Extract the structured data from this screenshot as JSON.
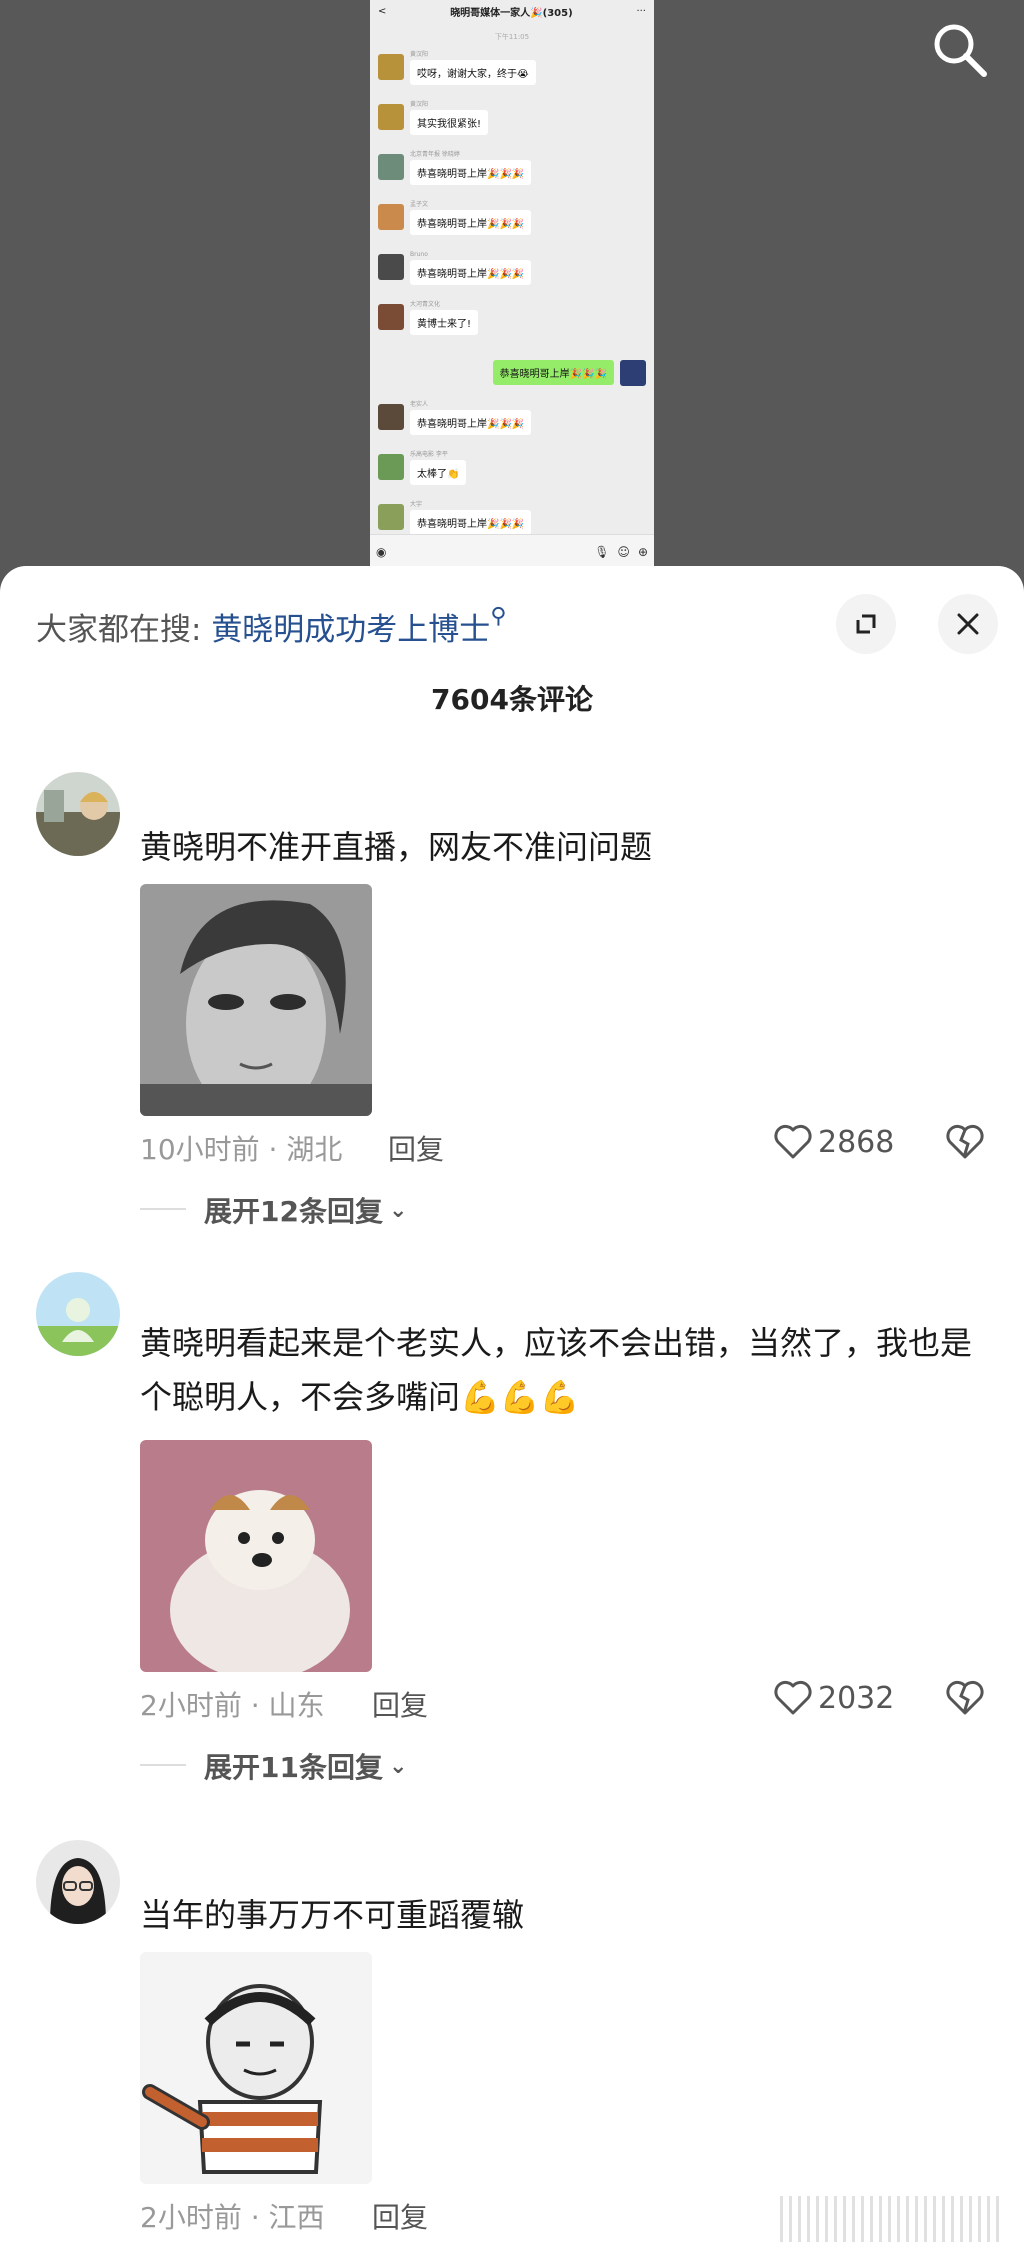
{
  "chat": {
    "title": "晓明哥媒体一家人🎉(305)",
    "back": "<",
    "more": "···",
    "time": "下午11:05",
    "messages": [
      {
        "name": "黄汉阳",
        "text": "哎呀，谢谢大家，终于😭"
      },
      {
        "name": "黄汉阳",
        "text": "其实我很紧张!"
      },
      {
        "name": "北京青年报 徐晓婷",
        "text": "恭喜晓明哥上岸🎉🎉🎉"
      },
      {
        "name": "孟子文",
        "text": "恭喜晓明哥上岸🎉🎉🎉"
      },
      {
        "name": "Bruno",
        "text": "恭喜晓明哥上岸🎉🎉🎉"
      },
      {
        "name": "大河青文化",
        "text": "黄博士来了!"
      },
      {
        "name": "",
        "text": "恭喜晓明哥上岸🎉🎉🎉",
        "self": true
      },
      {
        "name": "老实人",
        "text": "恭喜晓明哥上岸🎉🎉🎉"
      },
      {
        "name": "乐高电影 李平",
        "text": "太棒了👏"
      },
      {
        "name": "大宇",
        "text": "恭喜晓明哥上岸🎉🎉🎉"
      }
    ]
  },
  "sheet": {
    "search_prefix": "大家都在搜:",
    "search_keyword": "黄晓明成功考上博士",
    "comment_count": "7604条评论"
  },
  "comments": [
    {
      "text": "黄晓明不准开直播，网友不准问问题",
      "time_location": "10小时前 · 湖北",
      "reply_label": "回复",
      "likes": "2868",
      "expand_label": "展开12条回复"
    },
    {
      "text": "黄晓明看起来是个老实人，应该不会出错，当然了，我也是个聪明人，不会多嘴问💪💪💪",
      "time_location": "2小时前 · 山东",
      "reply_label": "回复",
      "likes": "2032",
      "expand_label": "展开11条回复"
    },
    {
      "text": "当年的事万万不可重蹈覆辙",
      "time_location": "2小时前 · 江西",
      "reply_label": "回复"
    }
  ],
  "colors": {
    "keyword": "#26508f",
    "top_background": "#585858",
    "chat_self_bubble": "#95ec69"
  }
}
